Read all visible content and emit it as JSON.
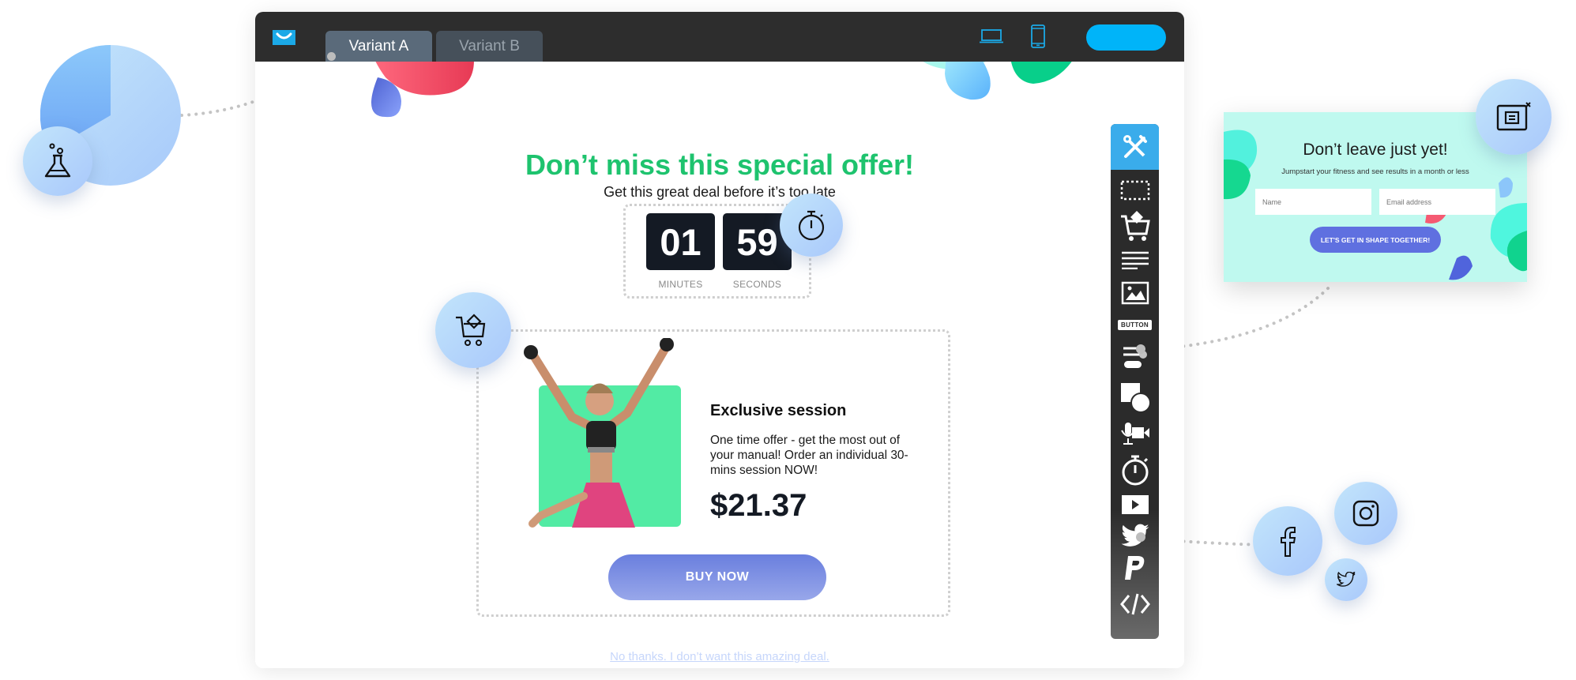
{
  "header": {
    "logo": "getresponse-smile-logo",
    "tabs": [
      {
        "label": "Variant A",
        "active": true
      },
      {
        "label": "Variant B",
        "active": false
      }
    ],
    "devices": [
      "desktop-icon",
      "mobile-icon"
    ],
    "accent_color": "#00b4f9"
  },
  "page": {
    "headline": "Don’t miss this special offer!",
    "subheadline": "Get this great deal before it’s too late",
    "countdown": {
      "minutes": "01",
      "seconds": "59",
      "minutes_label": "MINUTES",
      "seconds_label": "SECONDS"
    },
    "product": {
      "title": "Exclusive session",
      "description": "One time offer - get the most out of your manual! Order an individual 30-mins session NOW!",
      "price": "$21.37",
      "buy_label": "BUY NOW"
    },
    "decline_link": "No thanks. I don’t want this amazing deal.",
    "headline_color": "#1ec36e"
  },
  "toolbar": {
    "items": [
      {
        "icon": "tools-icon",
        "active": true
      },
      {
        "icon": "section-icon"
      },
      {
        "icon": "product-cart-icon"
      },
      {
        "icon": "text-icon"
      },
      {
        "icon": "image-icon"
      },
      {
        "icon": "button-icon",
        "label": "BUTTON"
      },
      {
        "icon": "form-icon"
      },
      {
        "icon": "shapes-icon"
      },
      {
        "icon": "webinar-icon"
      },
      {
        "icon": "timer-icon"
      },
      {
        "icon": "video-icon"
      },
      {
        "icon": "social-icon"
      },
      {
        "icon": "paypal-icon"
      },
      {
        "icon": "code-icon"
      }
    ],
    "active_color": "#3aaceb"
  },
  "popup_preview": {
    "title": "Don’t leave just yet!",
    "subtitle": "Jumpstart your fitness and see results in a month or less",
    "name_placeholder": "Name",
    "email_placeholder": "Email address",
    "button_label": "LET'S GET IN SHAPE TOGETHER!"
  },
  "feature_bubbles": [
    "ab-test-flask-icon",
    "stopwatch-icon",
    "cart-icon",
    "popup-icon",
    "facebook-icon",
    "instagram-icon",
    "twitter-icon"
  ]
}
